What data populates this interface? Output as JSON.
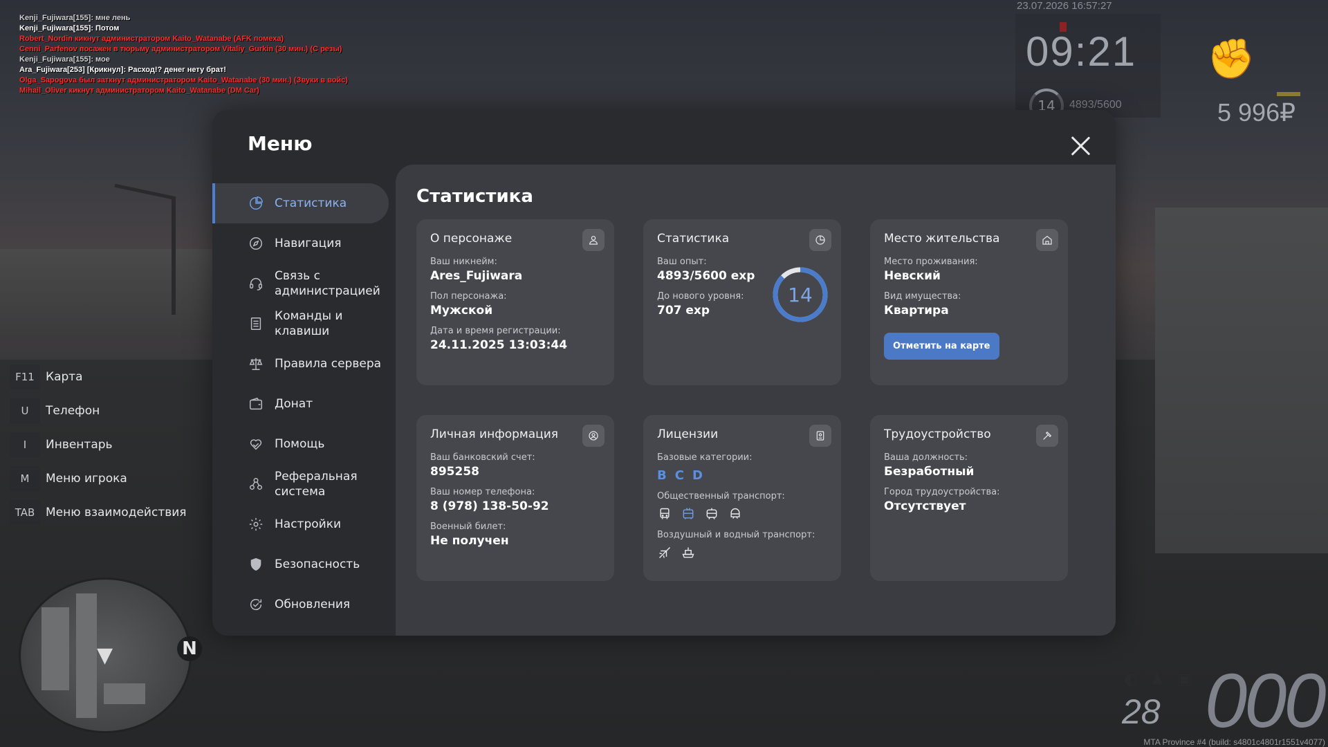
{
  "chat": [
    {
      "text": "Kenji_Fujiwara[155]: мне лень",
      "color": "gray"
    },
    {
      "text": "Kenji_Fujiwara[155]: Потом",
      "color": "white"
    },
    {
      "text": "Robert_Nordin кикнут администратором Kaito_Watanabe (AFK помеха)",
      "color": "red"
    },
    {
      "text": "Cenni_Parfenov посажен в тюрьму администратором Vitaliy_Gurkin (30 мин.) (С резы)",
      "color": "red"
    },
    {
      "text": "Kenji_Fujiwara[155]: мое",
      "color": "gray"
    },
    {
      "text": "Ara_Fujiwara[253] [Крикнул]: Расход!? денег нету брат!",
      "color": "white"
    },
    {
      "text": "Olga_Sapogova был заткнут администратором Kaito_Watanabe (30 мин.) (Звуки в войс)",
      "color": "red"
    },
    {
      "text": "Mihail_Oliver кикнут администратором Kaito_Watanabe (DM Car)",
      "color": "red"
    }
  ],
  "hud": {
    "datetime": "23.07.2026 16:57:27",
    "time": "09:21",
    "level": "14",
    "exp": "4893/5600",
    "money": "5 996₽",
    "speed": "000",
    "fuel": "28",
    "build": "MTA Province #4 (build: s4801c4801r1551v4077)"
  },
  "hotkeys": [
    {
      "key": "F11",
      "label": "Карта"
    },
    {
      "key": "U",
      "label": "Телефон"
    },
    {
      "key": "I",
      "label": "Инвентарь"
    },
    {
      "key": "M",
      "label": "Меню игрока"
    },
    {
      "key": "TAB",
      "label": "Меню взаимодействия"
    }
  ],
  "minimap": {
    "north": "N"
  },
  "menu": {
    "title": "Меню",
    "nav": [
      {
        "label": "Статистика",
        "icon": "pie-chart-icon",
        "active": true
      },
      {
        "label": "Навигация",
        "icon": "compass-icon"
      },
      {
        "label": "Связь с администрацией",
        "icon": "headset-icon"
      },
      {
        "label": "Команды и клавиши",
        "icon": "document-icon"
      },
      {
        "label": "Правила сервера",
        "icon": "scales-icon"
      },
      {
        "label": "Донат",
        "icon": "wallet-icon"
      },
      {
        "label": "Помощь",
        "icon": "heart-hand-icon"
      },
      {
        "label": "Реферальная система",
        "icon": "people-icon"
      },
      {
        "label": "Настройки",
        "icon": "gear-icon"
      },
      {
        "label": "Безопасность",
        "icon": "shield-icon"
      },
      {
        "label": "Обновления",
        "icon": "refresh-check-icon"
      }
    ],
    "content_title": "Статистика",
    "cards": {
      "character": {
        "title": "О персонаже",
        "nickname_label": "Ваш никнейм:",
        "nickname": "Ares_Fujiwara",
        "gender_label": "Пол персонажа:",
        "gender": "Мужской",
        "reg_label": "Дата и время регистрации:",
        "reg": "24.11.2025 13:03:44"
      },
      "stats": {
        "title": "Статистика",
        "exp_label": "Ваш опыт:",
        "exp": "4893/5600 exp",
        "next_label": "До нового уровня:",
        "next": "707 exp",
        "level": "14",
        "progress": 0.874
      },
      "residence": {
        "title": "Место жительства",
        "place_label": "Место проживания:",
        "place": "Невский",
        "type_label": "Вид имущества:",
        "type": "Квартира",
        "button": "Отметить на карте"
      },
      "personal": {
        "title": "Личная информация",
        "bank_label": "Ваш банковский счет:",
        "bank": "895258",
        "phone_label": "Ваш номер телефона:",
        "phone": "8 (978) 138-50-92",
        "military_label": "Военный билет:",
        "military": "Не получен"
      },
      "licenses": {
        "title": "Лицензии",
        "base_label": "Базовые категории:",
        "categories": [
          "B",
          "C",
          "D"
        ],
        "public_label": "Общественный транспорт:",
        "public_icons": [
          "bus-icon",
          "trolleybus-icon",
          "tram-icon",
          "metro-icon"
        ],
        "air_label": "Воздушный и водный транспорт:",
        "air_icons": [
          "plane-icon",
          "ship-icon"
        ]
      },
      "employment": {
        "title": "Трудоустройство",
        "position_label": "Ваша должность:",
        "position": "Безработный",
        "city_label": "Город трудоустройства:",
        "city": "Отсутствует"
      }
    }
  },
  "colors": {
    "accent": "#4c7fd0",
    "panel": "#2a2b2f",
    "content": "#3b3c41",
    "card": "#46474c",
    "chat_red": "#ff2a2a"
  }
}
